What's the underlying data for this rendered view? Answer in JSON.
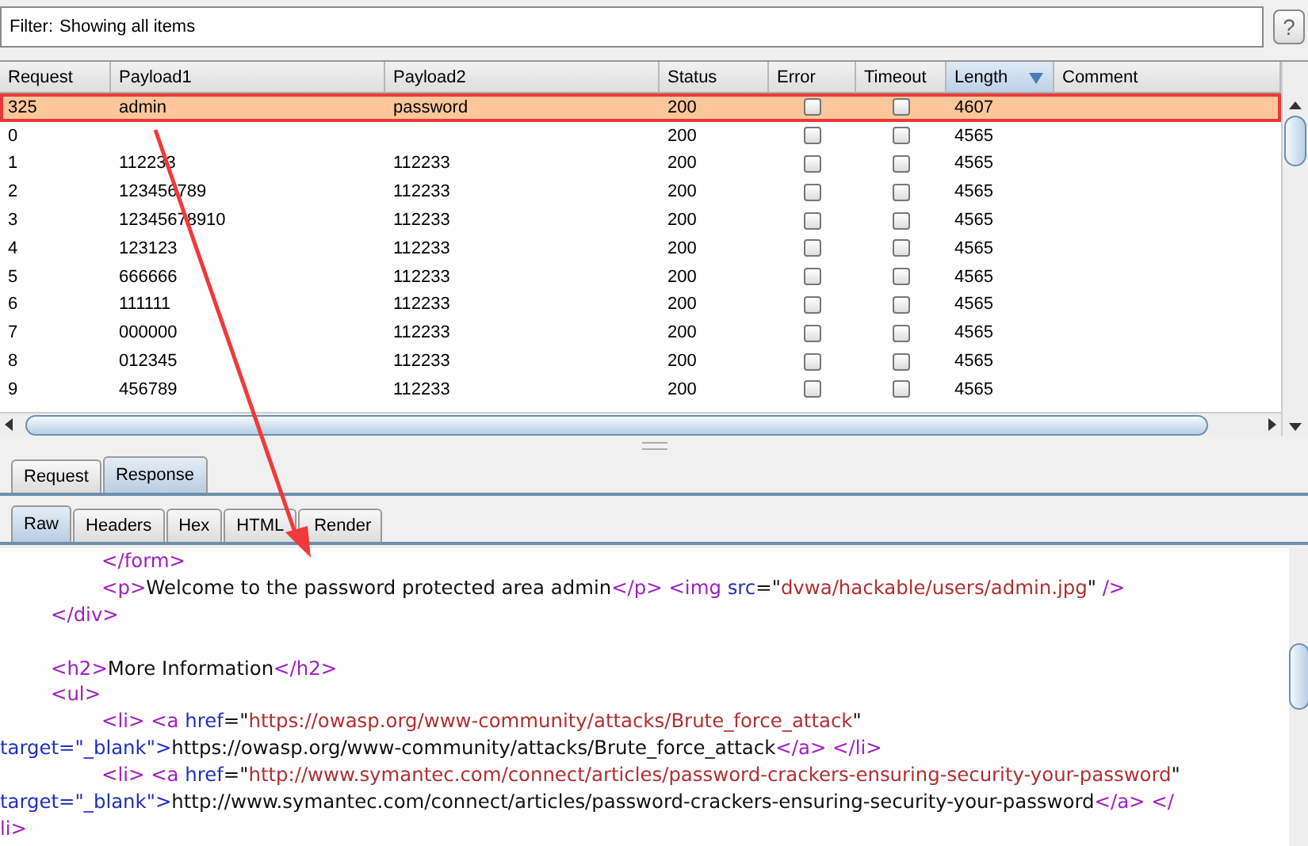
{
  "filter": {
    "label": "Filter:",
    "value": "Showing all items"
  },
  "help_button": {
    "label": "?"
  },
  "table": {
    "columns": [
      {
        "label": "Request",
        "sorted": false
      },
      {
        "label": "Payload1",
        "sorted": false
      },
      {
        "label": "Payload2",
        "sorted": false
      },
      {
        "label": "Status",
        "sorted": false
      },
      {
        "label": "Error",
        "sorted": false
      },
      {
        "label": "Timeout",
        "sorted": false
      },
      {
        "label": "Length",
        "sorted": true
      },
      {
        "label": "Comment",
        "sorted": false
      }
    ],
    "rows": [
      {
        "request": "325",
        "payload1": "admin",
        "payload2": "password",
        "status": "200",
        "error": false,
        "timeout": false,
        "length": "4607",
        "selected": true
      },
      {
        "request": "0",
        "status": "200",
        "error": false,
        "timeout": false,
        "length": "4565",
        "selected": false
      },
      {
        "request": "1",
        "payload1": "112233",
        "payload2": "112233",
        "status": "200",
        "error": false,
        "timeout": false,
        "length": "4565",
        "selected": false
      },
      {
        "request": "2",
        "payload1": "123456789",
        "payload2": "112233",
        "status": "200",
        "error": false,
        "timeout": false,
        "length": "4565",
        "selected": false
      },
      {
        "request": "3",
        "payload1": "12345678910",
        "payload2": "112233",
        "status": "200",
        "error": false,
        "timeout": false,
        "length": "4565",
        "selected": false
      },
      {
        "request": "4",
        "payload1": "123123",
        "payload2": "112233",
        "status": "200",
        "error": false,
        "timeout": false,
        "length": "4565",
        "selected": false
      },
      {
        "request": "5",
        "payload1": "666666",
        "payload2": "112233",
        "status": "200",
        "error": false,
        "timeout": false,
        "length": "4565",
        "selected": false
      },
      {
        "request": "6",
        "payload1": "111111",
        "payload2": "112233",
        "status": "200",
        "error": false,
        "timeout": false,
        "length": "4565",
        "selected": false
      },
      {
        "request": "7",
        "payload1": "000000",
        "payload2": "112233",
        "status": "200",
        "error": false,
        "timeout": false,
        "length": "4565",
        "selected": false
      },
      {
        "request": "8",
        "payload1": "012345",
        "payload2": "112233",
        "status": "200",
        "error": false,
        "timeout": false,
        "length": "4565",
        "selected": false
      },
      {
        "request": "9",
        "payload1": "456789",
        "payload2": "112233",
        "status": "200",
        "error": false,
        "timeout": false,
        "length": "4565",
        "selected": false
      }
    ]
  },
  "message_tabs": [
    {
      "label": "Request",
      "selected": false
    },
    {
      "label": "Response",
      "selected": true
    }
  ],
  "view_tabs": [
    {
      "label": "Raw",
      "selected": true
    },
    {
      "label": "Headers",
      "selected": false
    },
    {
      "label": "Hex",
      "selected": false
    },
    {
      "label": "HTML",
      "selected": false
    },
    {
      "label": "Render",
      "selected": false
    }
  ],
  "code_lines": [
    {
      "kind": "inner",
      "tokens": [
        {
          "kind": "tag",
          "text": "</form>"
        }
      ]
    },
    {
      "kind": "inner",
      "tokens": [
        {
          "kind": "tag",
          "text": "<p>"
        },
        {
          "kind": "text",
          "text": "Welcome to the password protected area admin"
        },
        {
          "kind": "tag",
          "text": "</p>"
        },
        {
          "kind": "tag",
          "text": " <img "
        },
        {
          "kind": "attr",
          "text": "src"
        },
        {
          "kind": "text",
          "text": "=\""
        },
        {
          "kind": "value",
          "text": "dvwa/hackable/users/admin.jpg"
        },
        {
          "kind": "text",
          "text": "\" "
        },
        {
          "kind": "tag",
          "text": "/>"
        }
      ]
    },
    {
      "kind": "mid",
      "tokens": [
        {
          "kind": "tag",
          "text": "</div>"
        }
      ]
    },
    {
      "kind": "blank"
    },
    {
      "kind": "mid",
      "tokens": [
        {
          "kind": "tag",
          "text": "<h2>"
        },
        {
          "kind": "text",
          "text": "More Information"
        },
        {
          "kind": "tag",
          "text": "</h2>"
        }
      ]
    },
    {
      "kind": "mid",
      "tokens": [
        {
          "kind": "tag",
          "text": "<ul>"
        }
      ]
    },
    {
      "kind": "inner",
      "tokens": [
        {
          "kind": "tag",
          "text": "<li> <a "
        },
        {
          "kind": "attr",
          "text": "href"
        },
        {
          "kind": "text",
          "text": "=\""
        },
        {
          "kind": "value",
          "text": "https://owasp.org/www-community/attacks/Brute_force_attack"
        },
        {
          "kind": "text",
          "text": "\""
        }
      ]
    },
    {
      "kind": "outer",
      "tokens": [
        {
          "kind": "attr",
          "text": "target=\"_blank\">"
        },
        {
          "kind": "text",
          "text": "https://owasp.org/www-community/attacks/Brute_force_attack"
        },
        {
          "kind": "tag",
          "text": "</a> </li>"
        }
      ]
    },
    {
      "kind": "inner",
      "tokens": [
        {
          "kind": "tag",
          "text": "<li> <a "
        },
        {
          "kind": "attr",
          "text": "href"
        },
        {
          "kind": "text",
          "text": "=\""
        },
        {
          "kind": "value",
          "text": "http://www.symantec.com/connect/articles/password-crackers-ensuring-security-your-password"
        },
        {
          "kind": "text",
          "text": "\""
        }
      ]
    },
    {
      "kind": "outer",
      "tokens": [
        {
          "kind": "attr",
          "text": "target=\"_blank\">"
        },
        {
          "kind": "text",
          "text": "http://www.symantec.com/connect/articles/password-crackers-ensuring-security-your-password"
        },
        {
          "kind": "tag",
          "text": "</a> </"
        }
      ]
    },
    {
      "kind": "outer",
      "tokens": [
        {
          "kind": "tag",
          "text": "li>"
        }
      ]
    }
  ]
}
